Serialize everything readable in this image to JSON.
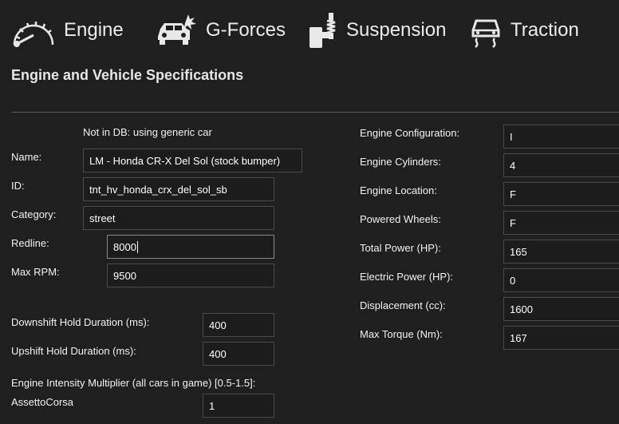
{
  "tabs": [
    {
      "label": "Engine",
      "icon": "speedometer-icon"
    },
    {
      "label": "G-Forces",
      "icon": "car-crash-icon"
    },
    {
      "label": "Suspension",
      "icon": "suspension-icon"
    },
    {
      "label": "Traction",
      "icon": "traction-skid-icon"
    }
  ],
  "section_title": "Engine and Vehicle Specifications",
  "left": {
    "note": "Not in DB: using generic car",
    "name_label": "Name:",
    "name_value": "LM - Honda CR-X Del Sol (stock bumper)",
    "id_label": "ID:",
    "id_value": "tnt_hv_honda_crx_del_sol_sb",
    "category_label": "Category:",
    "category_value": "street",
    "redline_label": "Redline:",
    "redline_value": "8000",
    "maxrpm_label": "Max RPM:",
    "maxrpm_value": "9500",
    "downshift_label": "Downshift Hold Duration (ms):",
    "downshift_value": "400",
    "upshift_label": "Upshift Hold Duration (ms):",
    "upshift_value": "400",
    "intensity_label": "Engine Intensity Multiplier (all cars in game) [0.5-1.5]:",
    "game_label": "AssettoCorsa",
    "game_value": "1"
  },
  "right": {
    "config_label": "Engine Configuration:",
    "config_value": "I",
    "cylinders_label": "Engine Cylinders:",
    "cylinders_value": "4",
    "location_label": "Engine Location:",
    "location_value": "F",
    "wheels_label": "Powered Wheels:",
    "wheels_value": "F",
    "power_label": "Total Power (HP):",
    "power_value": "165",
    "electric_label": "Electric Power (HP):",
    "electric_value": "0",
    "displacement_label": "Displacement (cc):",
    "displacement_value": "1600",
    "torque_label": "Max Torque (Nm):",
    "torque_value": "167"
  }
}
